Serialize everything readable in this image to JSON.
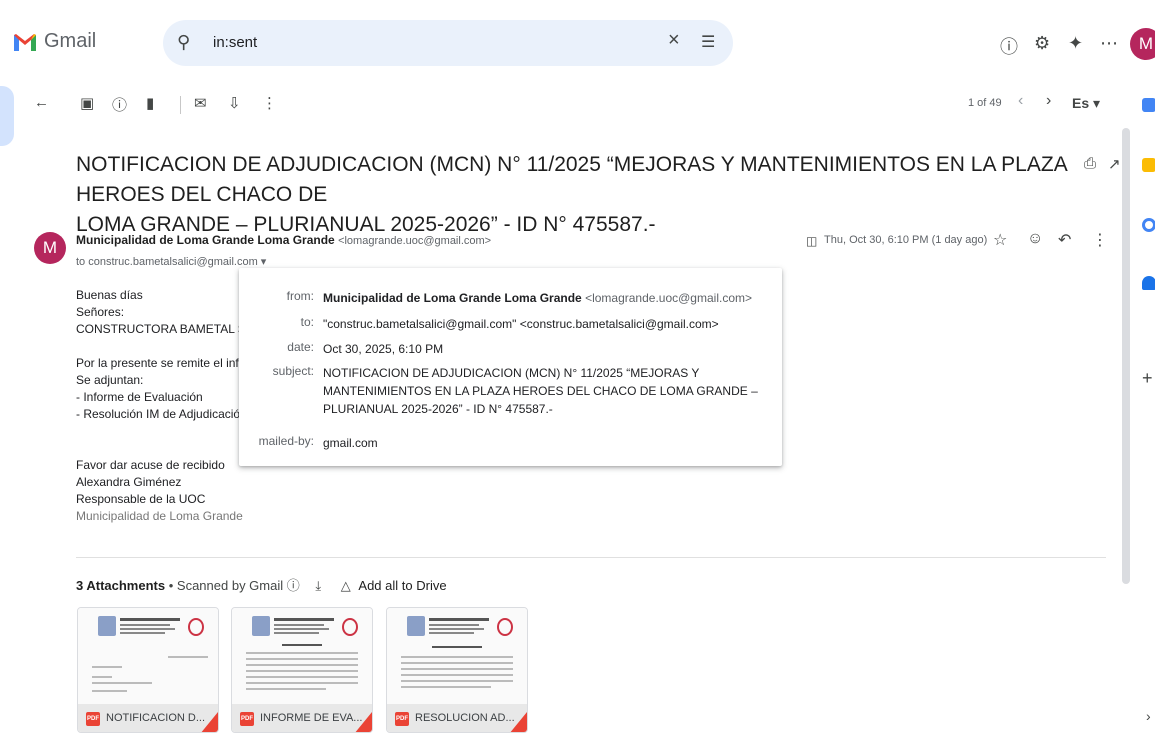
{
  "header": {
    "app_name": "Gmail",
    "search_value": "in:sent",
    "avatar_initial": "M"
  },
  "toolbar": {
    "pager": "1 of 49",
    "lang": "Es"
  },
  "email": {
    "subject_line1": "NOTIFICACION DE ADJUDICACION (MCN) N° 11/2025 “MEJORAS Y MANTENIMIENTOS EN LA PLAZA HEROES DEL CHACO DE",
    "subject_line2": "LOMA GRANDE – PLURIANUAL 2025-2026” - ID N° 475587.-",
    "sender_initial": "M",
    "sender_name": "Municipalidad de Loma Grande Loma Grande",
    "sender_email": "<lomagrande.uoc@gmail.com>",
    "to_line": "to construc.bametalsalici@gmail.com",
    "date": "Thu, Oct 30, 6:10 PM (1 day ago)",
    "body": [
      "Buenas días",
      "Señores:",
      "CONSTRUCTORA BAMETAL S.A.",
      "",
      "Por la presente se remite el informe",
      " Se adjuntan:",
      "- Informe de Evaluación",
      "- Resolución IM de Adjudicación",
      "",
      "",
      "Favor dar acuse de recibido",
      "Alexandra Giménez",
      "Responsable de la UOC"
    ],
    "signature_org": "Municipalidad de Loma Grande"
  },
  "details_popup": {
    "from_label": "from:",
    "from_name": "Municipalidad de Loma Grande Loma Grande",
    "from_email": "<lomagrande.uoc@gmail.com>",
    "to_label": "to:",
    "to_value": "\"construc.bametalsalici@gmail.com\" <construc.bametalsalici@gmail.com>",
    "date_label": "date:",
    "date_value": "Oct 30, 2025, 6:10 PM",
    "subject_label": "subject:",
    "subject_value": "NOTIFICACION DE ADJUDICACION (MCN) N° 11/2025 “MEJORAS Y MANTENIMIENTOS EN LA PLAZA HEROES DEL CHACO DE LOMA GRANDE – PLURIANUAL 2025-2026” - ID N° 475587.-",
    "mailedby_label": "mailed-by:",
    "mailedby_value": "gmail.com"
  },
  "attachments": {
    "count_label": "3 Attachments",
    "scanned": "Scanned by Gmail",
    "add_all": "Add all to Drive",
    "items": [
      {
        "name": "NOTIFICACION D..."
      },
      {
        "name": "INFORME DE EVA..."
      },
      {
        "name": "RESOLUCION AD..."
      }
    ]
  },
  "icons": {
    "search": "search-icon",
    "clear": "close-icon",
    "tune": "tune-icon",
    "help": "help-icon",
    "settings": "gear-icon",
    "gemini": "sparkle-icon",
    "apps": "apps-grid-icon"
  },
  "colors": {
    "accent": "#b5265d",
    "search_bg": "#eaf1fb",
    "pdf_red": "#ea4335"
  }
}
